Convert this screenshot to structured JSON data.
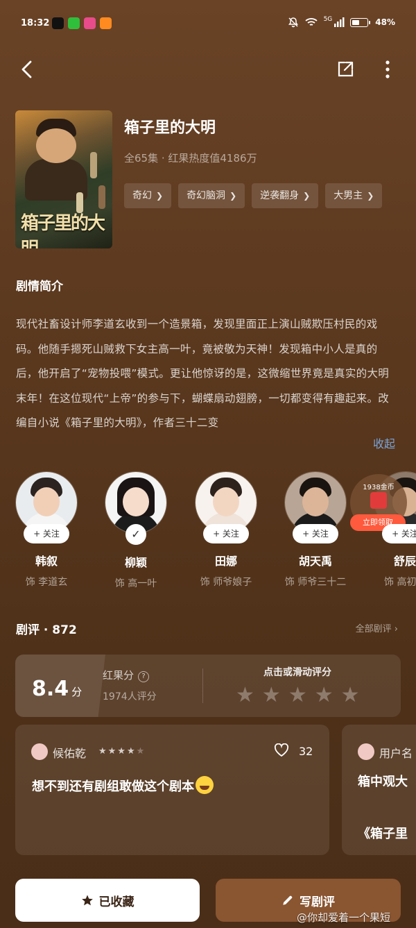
{
  "status_bar": {
    "time": "18:32",
    "signal": "5G",
    "battery": "48%"
  },
  "drama": {
    "title": "箱子里的大明",
    "meta": "全65集 · 红果热度值4186万",
    "poster_text": "箱子里的大明",
    "tags": [
      "奇幻",
      "奇幻脑洞",
      "逆袭翻身",
      "大男主"
    ]
  },
  "synopsis": {
    "heading": "剧情简介",
    "text": "现代社畜设计师李道玄收到一个造景箱，发现里面正上演山贼欺压村民的戏码。他随手摁死山贼救下女主高一叶，竟被敬为天神！发现箱中小人是真的后，他开启了“宠物投喂”模式。更让他惊讶的是，这微缩世界竟是真实的大明末年！在这位现代“上帝”的参与下，蝴蝶扇动翅膀，一切都变得有趣起来。改编自小说《箱子里的大明》，作者三十二变",
    "collapse_label": "收起"
  },
  "cast": [
    {
      "name": "韩叙",
      "role": "饰 李道玄",
      "follow": "+ 关注"
    },
    {
      "name": "柳颖",
      "role": "饰 高一叶",
      "follow": "✓"
    },
    {
      "name": "田娜",
      "role": "饰 师爷娘子",
      "follow": "+ 关注"
    },
    {
      "name": "胡天禹",
      "role": "饰 师爷三十二",
      "follow": "+ 关注"
    },
    {
      "name": "舒辰",
      "role": "饰 高初",
      "follow": "+ 关注"
    }
  ],
  "coin_popup": {
    "amount": "1938金币",
    "button": "立即领取"
  },
  "reviews": {
    "heading": "剧评 · 872",
    "all_label": "全部剧评",
    "score": "8.4",
    "score_unit": "分",
    "score_label": "红果分",
    "rater_count": "1974人评分",
    "rate_hint": "点击或滑动评分",
    "cards": [
      {
        "user": "候佑乾",
        "stars": 4,
        "likes": "32",
        "text": "想不到还有剧组敢做这个剧本"
      },
      {
        "user": "用户名",
        "text1": "箱中观大",
        "text2": "《箱子里"
      }
    ]
  },
  "actions": {
    "favorite": "已收藏",
    "write_review": "写剧评"
  },
  "watermark": "@你却爱着一个果短"
}
